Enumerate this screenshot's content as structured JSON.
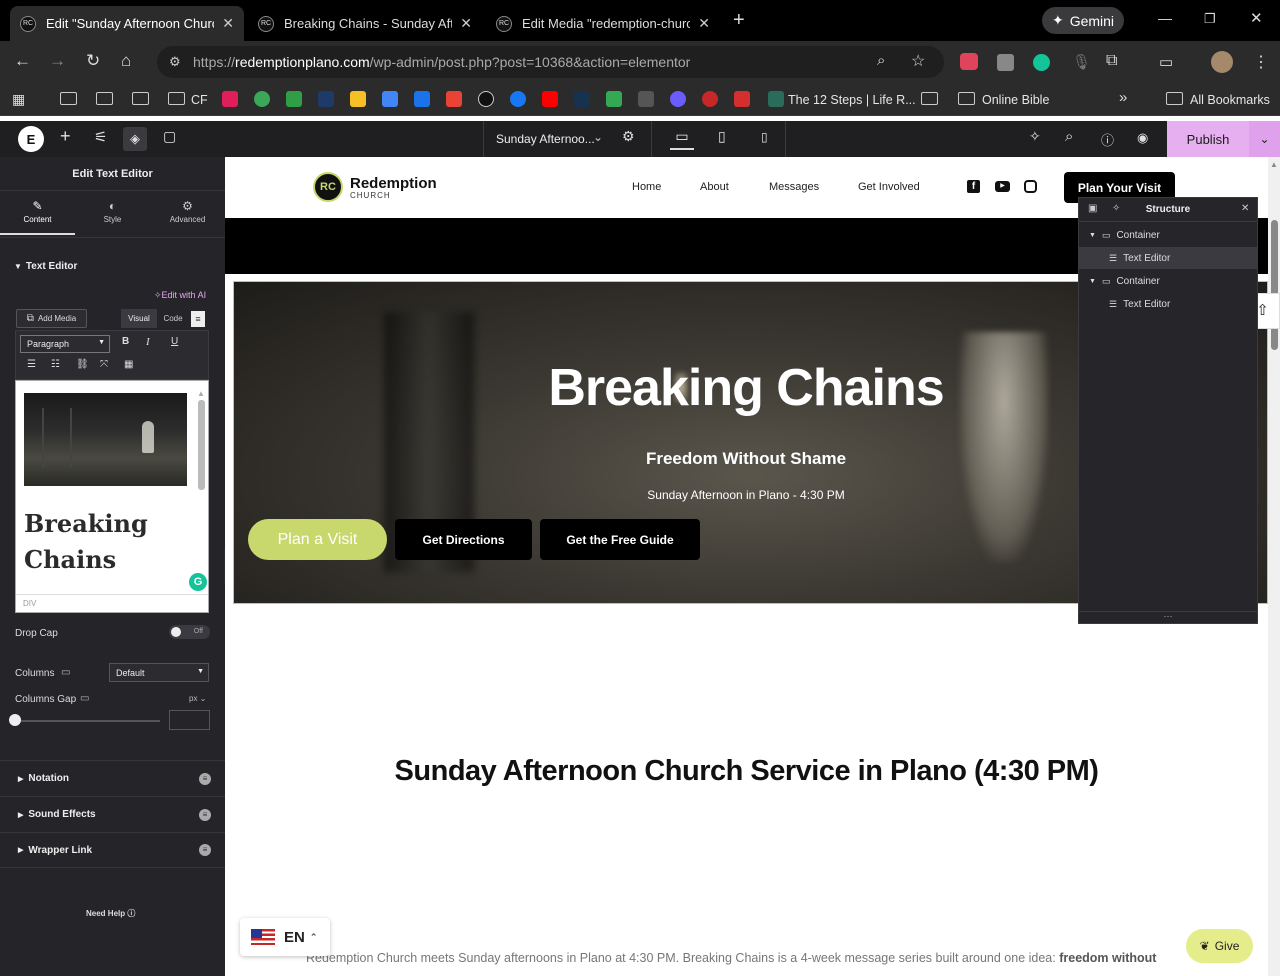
{
  "browser": {
    "tabs": [
      {
        "title": "Edit \"Sunday Afternoon Church"
      },
      {
        "title": "Breaking Chains - Sunday Aftern"
      },
      {
        "title": "Edit Media \"redemption-church"
      }
    ],
    "gemini_label": "Gemini",
    "url_protocol": "https://",
    "url_host": "redemptionplano.com",
    "url_path": "/wp-admin/post.php?post=10368&action=elementor",
    "bookmarks": {
      "cf": "CF",
      "twelve_steps": "The 12 Steps | Life R...",
      "online_bible": "Online Bible",
      "all_bookmarks": "All Bookmarks"
    }
  },
  "elementor": {
    "page_title": "Sunday Afternoo...",
    "publish_label": "Publish",
    "panel": {
      "title": "Edit Text Editor",
      "tabs": [
        "Content",
        "Style",
        "Advanced"
      ],
      "section_text_editor": "Text Editor",
      "edit_with_ai": "Edit with AI",
      "add_media": "Add Media",
      "visual_tab": "Visual",
      "code_tab": "Code",
      "format_select": "Paragraph",
      "preview_heading": "Breaking Chains",
      "preview_status": "DIV",
      "drop_cap_label": "Drop Cap",
      "drop_cap_state": "Off",
      "columns_label": "Columns",
      "columns_value": "Default",
      "columns_gap_label": "Columns Gap",
      "columns_gap_unit": "px",
      "sections": [
        "Notation",
        "Sound Effects",
        "Wrapper Link"
      ],
      "need_help": "Need Help"
    },
    "structure": {
      "title": "Structure",
      "items": [
        {
          "label": "Container",
          "level": 0
        },
        {
          "label": "Text Editor",
          "level": 1
        },
        {
          "label": "Container",
          "level": 0
        },
        {
          "label": "Text Editor",
          "level": 1
        }
      ]
    }
  },
  "site": {
    "logo_name": "Redemption",
    "logo_sub": "CHURCH",
    "nav": [
      "Home",
      "About",
      "Messages",
      "Get Involved"
    ],
    "cta": "Plan Your Visit",
    "hero": {
      "title": "Breaking Chains",
      "subtitle": "Freedom Without Shame",
      "time": "Sunday Afternoon in Plano - 4:30 PM",
      "buttons": [
        "Plan a Visit",
        "Get Directions",
        "Get the Free Guide"
      ]
    },
    "main_title": "Sunday Afternoon Church Service in Plano (4:30 PM)",
    "body_text": "Redemption Church meets Sunday afternoons in Plano at 4:30 PM. Breaking Chains is a 4-week message series built around one idea:",
    "body_bold": "freedom without",
    "lang": "EN",
    "give": "Give"
  },
  "colors": {
    "accent": "#e6b0f0",
    "lime": "#c8d86c",
    "give": "#e5ec8a"
  }
}
